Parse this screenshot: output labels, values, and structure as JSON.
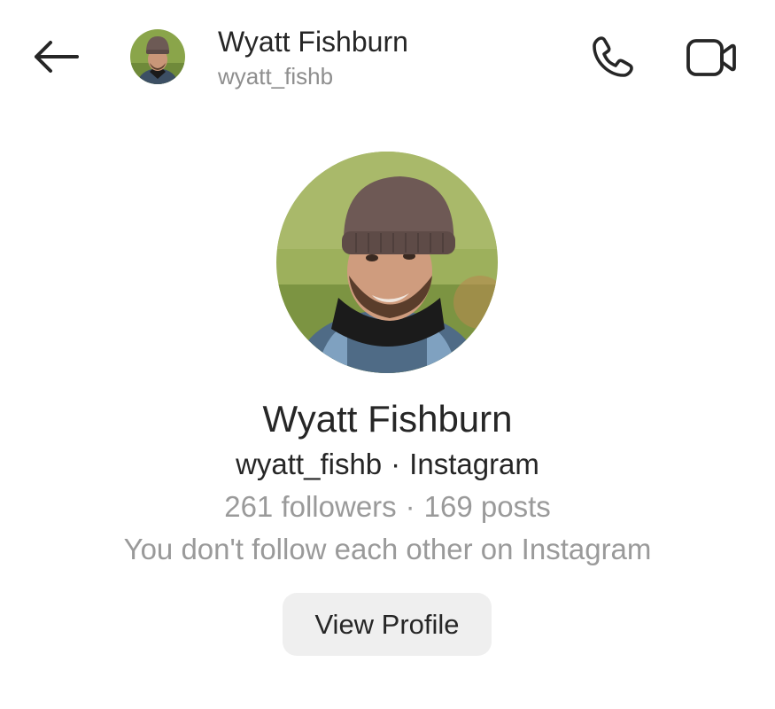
{
  "header": {
    "name": "Wyatt Fishburn",
    "username": "wyatt_fishb",
    "icons": {
      "back": "arrow-left-icon",
      "call": "phone-icon",
      "video": "video-camera-icon"
    }
  },
  "profile": {
    "name": "Wyatt Fishburn",
    "username": "wyatt_fishb",
    "platform": "Instagram",
    "followers": "261 followers",
    "posts": "169 posts",
    "follow_status": "You don't follow each other on Instagram",
    "view_profile_label": "View Profile"
  },
  "colors": {
    "primary_text": "#262626",
    "secondary_text": "#8e8e8e",
    "button_bg": "#efefef"
  }
}
